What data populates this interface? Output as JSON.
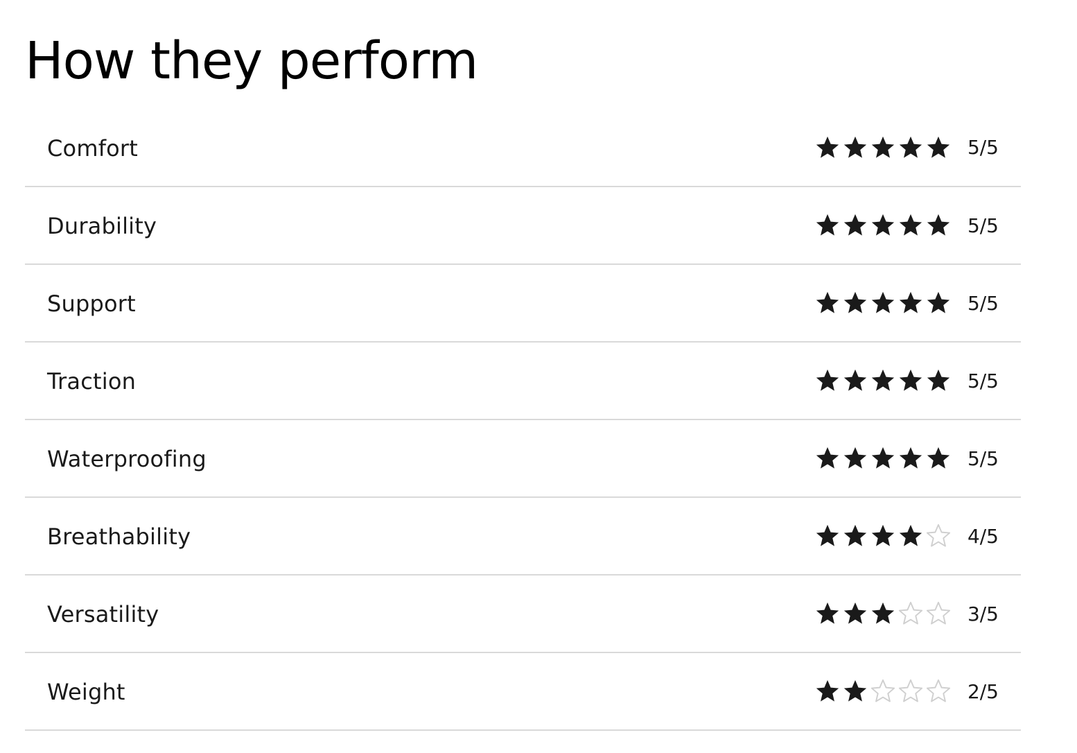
{
  "page": {
    "title": "How they perform"
  },
  "colors": {
    "star_filled": "#1a1a1a",
    "star_empty_stroke": "#cfcfcf",
    "divider": "#d9d9d9"
  },
  "ratings": [
    {
      "label": "Comfort",
      "value": 5,
      "max": 5,
      "score_text": "5/5"
    },
    {
      "label": "Durability",
      "value": 5,
      "max": 5,
      "score_text": "5/5"
    },
    {
      "label": "Support",
      "value": 5,
      "max": 5,
      "score_text": "5/5"
    },
    {
      "label": "Traction",
      "value": 5,
      "max": 5,
      "score_text": "5/5"
    },
    {
      "label": "Waterproofing",
      "value": 5,
      "max": 5,
      "score_text": "5/5"
    },
    {
      "label": "Breathability",
      "value": 4,
      "max": 5,
      "score_text": "4/5"
    },
    {
      "label": "Versatility",
      "value": 3,
      "max": 5,
      "score_text": "3/5"
    },
    {
      "label": "Weight",
      "value": 2,
      "max": 5,
      "score_text": "2/5"
    }
  ]
}
